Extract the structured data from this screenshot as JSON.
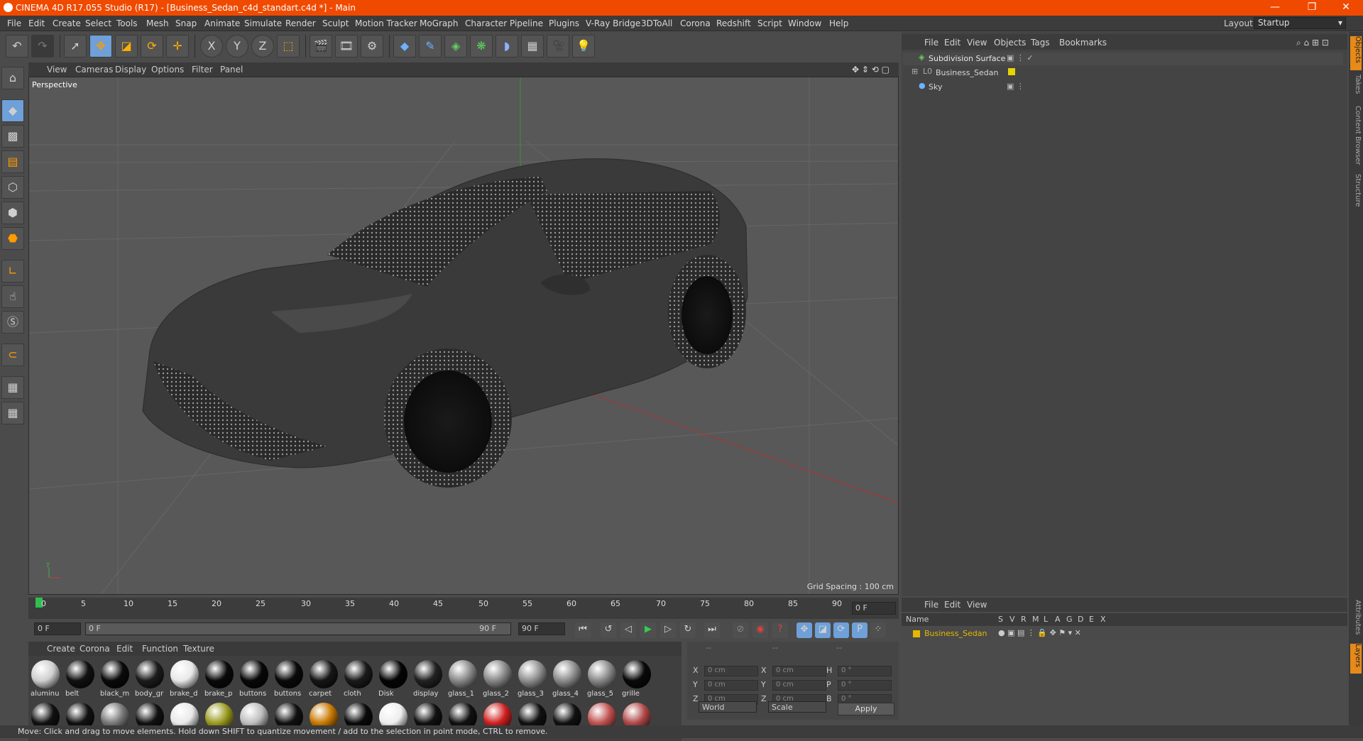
{
  "window": {
    "title": "CINEMA 4D R17.055 Studio (R17) - [Business_Sedan_c4d_standart.c4d *] - Main",
    "minimize": "—",
    "restore": "❐",
    "close": "✕"
  },
  "menu": [
    "File",
    "Edit",
    "Create",
    "Select",
    "Tools",
    "Mesh",
    "Snap",
    "Animate",
    "Simulate",
    "Render",
    "Sculpt",
    "Motion Tracker",
    "MoGraph",
    "Character",
    "Pipeline",
    "Plugins",
    "V-Ray Bridge",
    "3DToAll",
    "Corona",
    "Redshift",
    "Script",
    "Window",
    "Help"
  ],
  "layout": {
    "label": "Layout:",
    "value": "Startup"
  },
  "viewport": {
    "menu": [
      "View",
      "Cameras",
      "Display",
      "Options",
      "Filter",
      "Panel"
    ],
    "label": "Perspective",
    "grid_spacing": "Grid Spacing : 100 cm"
  },
  "objects": {
    "menu": [
      "File",
      "Edit",
      "View",
      "Objects",
      "Tags",
      "Bookmarks"
    ],
    "items": [
      {
        "name": "Subdivision Surface",
        "color": "#e8e8e8"
      },
      {
        "name": "Business_Sedan",
        "color": "#d6d6d6"
      },
      {
        "name": "Sky",
        "color": "#d6d6d6"
      }
    ]
  },
  "side_tabs": [
    "Objects",
    "Takes",
    "Content Browser",
    "Structure",
    "Attributes",
    "Layers"
  ],
  "timeline": {
    "ticks": [
      "0",
      "5",
      "10",
      "15",
      "20",
      "25",
      "30",
      "35",
      "40",
      "45",
      "50",
      "55",
      "60",
      "65",
      "70",
      "75",
      "80",
      "85",
      "90"
    ],
    "current_frame": "0 F",
    "start": "0 F",
    "range_start": "0 F",
    "range_end": "90 F",
    "end": "90 F"
  },
  "materials": {
    "menu": [
      "Create",
      "Corona",
      "Edit",
      "Function",
      "Texture"
    ],
    "row1": [
      "aluminu",
      "belt",
      "black_m",
      "body_gr",
      "brake_d",
      "brake_p",
      "buttons",
      "buttons",
      "carpet",
      "cloth",
      "Disk",
      "display",
      "glass_1",
      "glass_2",
      "glass_3",
      "glass_4",
      "glass_5",
      "grille"
    ]
  },
  "coords": {
    "header": [
      "--",
      "--",
      "--"
    ],
    "rows": [
      {
        "a": "X",
        "av": "0 cm",
        "b": "X",
        "bv": "0 cm",
        "c": "H",
        "cv": "0 °"
      },
      {
        "a": "Y",
        "av": "0 cm",
        "b": "Y",
        "bv": "0 cm",
        "c": "P",
        "cv": "0 °"
      },
      {
        "a": "Z",
        "av": "0 cm",
        "b": "Z",
        "bv": "0 cm",
        "c": "B",
        "cv": "0 °"
      }
    ],
    "mode": "World",
    "scale": "Scale",
    "apply": "Apply"
  },
  "layers": {
    "menu": [
      "File",
      "Edit",
      "View"
    ],
    "headers": [
      "Name",
      "S",
      "V",
      "R",
      "M",
      "L",
      "A",
      "G",
      "D",
      "E",
      "X"
    ],
    "items": [
      {
        "name": "Business_Sedan",
        "color": "#e6b800"
      }
    ]
  },
  "status": "Move: Click and drag to move elements. Hold down SHIFT to quantize movement / add to the selection in point mode, CTRL to remove.",
  "accent": "#f04a00"
}
